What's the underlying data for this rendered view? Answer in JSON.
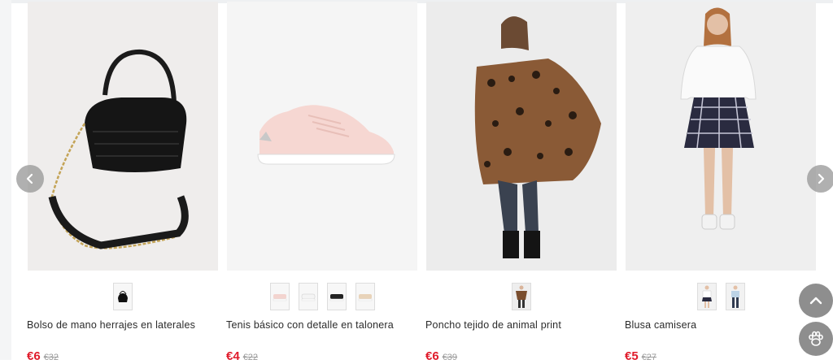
{
  "carousel": {
    "prev_icon": "chevron-left-icon",
    "next_icon": "chevron-right-icon",
    "products": [
      {
        "title": "Bolso de mano herrajes en laterales",
        "price": "€6",
        "old_price": "€32",
        "image": "black-croc-handbag",
        "swatches": [
          "black-bag"
        ]
      },
      {
        "title": "Tenis básico con detalle en talonera",
        "price": "€4",
        "old_price": "€22",
        "image": "pink-sneaker",
        "swatches": [
          "pink-sneaker",
          "white-sneaker",
          "black-sneaker",
          "beige-sneaker"
        ]
      },
      {
        "title": "Poncho tejido de animal print",
        "price": "€6",
        "old_price": "€39",
        "image": "leopard-poncho-model",
        "swatches": [
          "leopard-poncho"
        ]
      },
      {
        "title": "Blusa camisera",
        "price": "€5",
        "old_price": "€27",
        "image": "white-blouse-model",
        "swatches": [
          "white-blouse",
          "light-blue-blouse"
        ]
      }
    ]
  },
  "floating_buttons": {
    "scroll_top_icon": "chevron-up-icon",
    "pet_icon": "paw-icon"
  },
  "colors": {
    "price_red": "#e01b2b",
    "old_price_gray": "#999999",
    "button_gray": "#8e8e8e"
  }
}
